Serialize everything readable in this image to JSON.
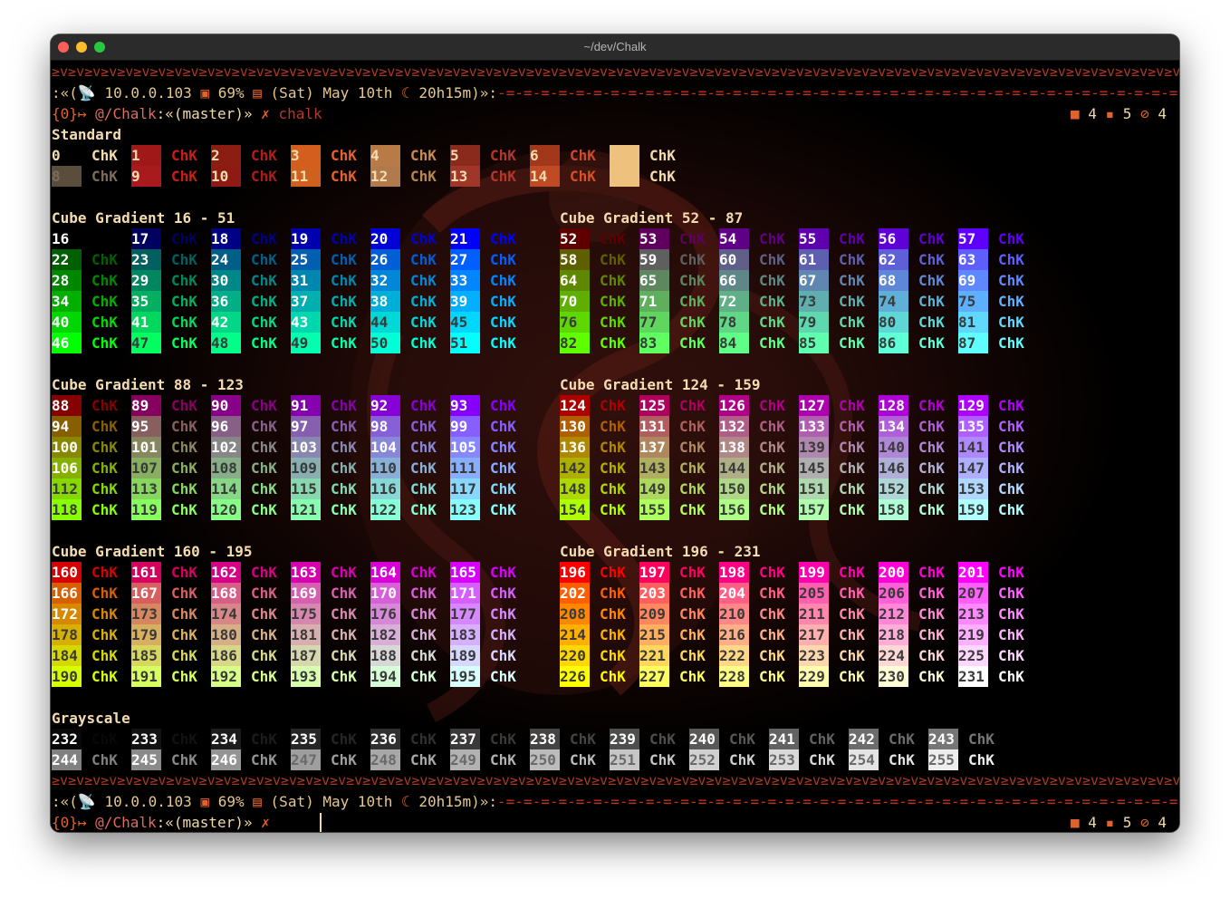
{
  "window": {
    "title": "~/dev/Chalk"
  },
  "prompt": {
    "decor": "≥v≥v≥v≥v≥v≥v≥v≥v≥v≥v≥v≥v≥v≥v≥v≥v≥v≥v≥v≥v≥v≥v≥v≥v≥v≥v≥v≥v≥v≥v≥v≥v≥v≥v≥v≥v≥v≥v≥v≥v≥v≥v≥v≥v≥v≥v≥v≥v≥v≥v≥v≥v≥v≥v≥v≥v≥v≥v≥v≥v≥v≥v≥v≥v≥v≥v≥v≥v≥v≥v≥v≥v≥v≥v",
    "open": ":«(",
    "net_icon": "📡",
    "ip": "10.0.0.103",
    "battery_icon": "▣",
    "battery": "69%",
    "cal_icon": "▤",
    "date": "(Sat) May 10th",
    "moon_icon": "☾",
    "uptime": "20h15m",
    "close": ")»:",
    "dashes": "-=-=-=-=-=-=-=-=-=-=-=-=-=-=-=-=-=-=-=-=-=-=-=-=-=-=-=-=-=-=-=-=-=-=-=-=-=-=-=-=-=-=-=-=-",
    "job_tag": "{0}↦",
    "dir": "@/Chalk",
    "branch": ":«(master)»",
    "x": "✗",
    "command": "chalk",
    "folder_icon": "■",
    "folders": "4",
    "file_icon": "▪",
    "files": "5",
    "hidden_icon": "⊘",
    "hidden": "4"
  },
  "sample_text": "ChK",
  "sections": {
    "standard": "Standard",
    "cube_16": "Cube Gradient 16 - 51",
    "cube_52": "Cube Gradient 52 - 87",
    "cube_88": "Cube Gradient 88 - 123",
    "cube_124": "Cube Gradient 124 - 159",
    "cube_160": "Cube Gradient 160 - 195",
    "cube_196": "Cube Gradient 196 - 231",
    "grayscale": "Grayscale"
  },
  "palette_override": {
    "0": "#000000",
    "1": "#a01818",
    "2": "#8b1d12",
    "3": "#d35e1e",
    "4": "#b87a46",
    "5": "#8a2a1c",
    "6": "#a3371c",
    "7": "#eec17c",
    "8": "#5a4d3c",
    "9": "#a81a1e",
    "10": "#8e1a14",
    "11": "#d0601e",
    "12": "#b07a4c",
    "13": "#a0352a",
    "14": "#c04a24",
    "15": "#eec17c"
  },
  "standard_text_colors": [
    "#f5dcae",
    "#c81e16",
    "#b01e1a",
    "#e0622d",
    "#c88a54",
    "#b3372a",
    "#cc4a2e",
    "#f5dcae",
    "#7d6c5a",
    "#c81e16",
    "#a81e1a",
    "#e0622d",
    "#b88650",
    "#b3372a",
    "#d65028",
    "#f5dcae"
  ]
}
